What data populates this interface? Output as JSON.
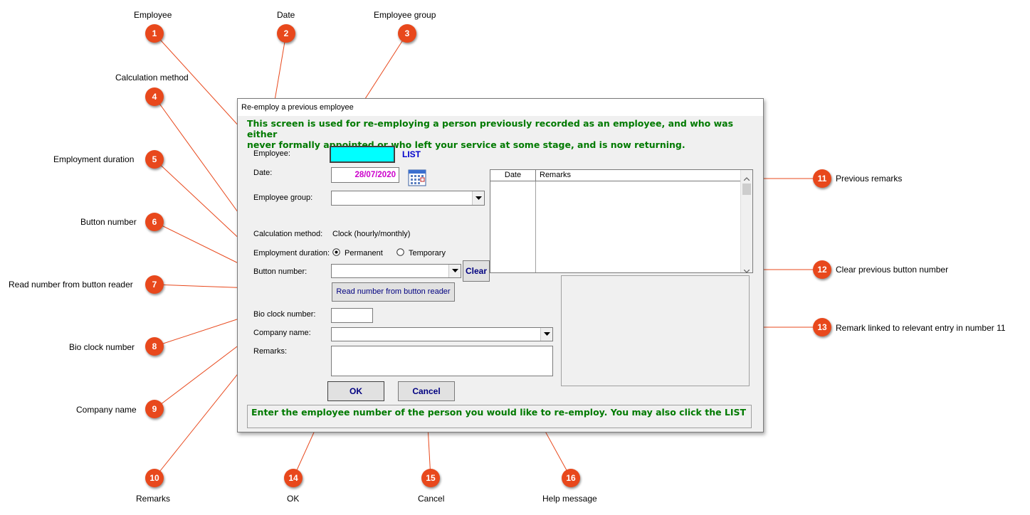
{
  "annotations": {
    "c1": {
      "num": "1",
      "label": "Employee"
    },
    "c2": {
      "num": "2",
      "label": "Date"
    },
    "c3": {
      "num": "3",
      "label": "Employee group"
    },
    "c4": {
      "num": "4",
      "label": "Calculation method"
    },
    "c5": {
      "num": "5",
      "label": "Employment duration"
    },
    "c6": {
      "num": "6",
      "label": "Button number"
    },
    "c7": {
      "num": "7",
      "label": "Read number from button reader"
    },
    "c8": {
      "num": "8",
      "label": "Bio clock number"
    },
    "c9": {
      "num": "9",
      "label": "Company name"
    },
    "c10": {
      "num": "10",
      "label": "Remarks"
    },
    "c11": {
      "num": "11",
      "label": "Previous remarks"
    },
    "c12": {
      "num": "12",
      "label": "Clear previous button number"
    },
    "c13": {
      "num": "13",
      "label": "Remark linked to relevant entry in number 11"
    },
    "c14": {
      "num": "14",
      "label": "OK"
    },
    "c15": {
      "num": "15",
      "label": "Cancel"
    },
    "c16": {
      "num": "16",
      "label": "Help message"
    }
  },
  "window": {
    "title": "Re-employ a previous employee",
    "intro_line1": "This screen is used for re-employing a person previously recorded as an employee, and who was either",
    "intro_line2": "never formally appointed or who left your service at some stage, and is now returning."
  },
  "form": {
    "employee_label": "Employee:",
    "employee_value": "",
    "list_link": "LIST",
    "date_label": "Date:",
    "date_value": "28/07/2020",
    "employee_group_label": "Employee group:",
    "employee_group_value": "",
    "calc_method_label": "Calculation method:",
    "calc_method_value": "Clock (hourly/monthly)",
    "duration_label": "Employment duration:",
    "duration_permanent": "Permanent",
    "duration_temporary": "Temporary",
    "button_number_label": "Button number:",
    "button_number_value": "",
    "clear_button": "Clear",
    "read_button": "Read number from button reader",
    "bio_clock_label": "Bio clock number:",
    "bio_clock_value": "",
    "company_label": "Company name:",
    "company_value": "",
    "remarks_label": "Remarks:",
    "remarks_value": "",
    "ok_button": "OK",
    "cancel_button": "Cancel"
  },
  "grid": {
    "columns": [
      "Date",
      "Remarks"
    ],
    "rows": []
  },
  "help_message": "Enter the employee number of the person you would like to re-employ. You may also click the LIST",
  "colors": {
    "callout": "#e8481c",
    "intro_text": "#007a00",
    "employee_field": "#00ffff",
    "date_text": "#cc00cc",
    "button_text": "#000080"
  },
  "icons": {
    "calendar": "calendar-icon",
    "radio_selected": "radio-selected-icon",
    "radio_empty": "radio-empty-icon",
    "dropdown": "chevron-down-icon"
  }
}
